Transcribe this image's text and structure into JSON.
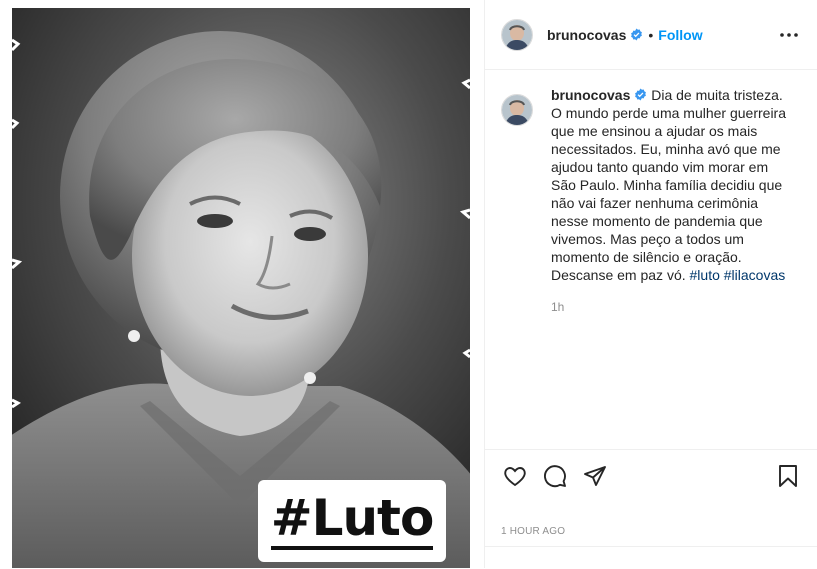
{
  "media": {
    "hashtag_overlay": "#Luto"
  },
  "header": {
    "username": "brunocovas",
    "separator": "•",
    "follow_label": "Follow",
    "more_icon": "more-horizontal-icon"
  },
  "caption": {
    "username": "brunocovas",
    "text": "Dia de muita tristeza. O mundo perde uma mulher guerreira que me ensinou a ajudar os mais necessitados. Eu, minha avó que me ajudou tanto quando vim morar em São Paulo. Minha família decidiu que não vai fazer nenhuma cerimônia nesse momento de pandemia que vivemos. Mas peço a todos um momento de silêncio e oração. Descanse em paz vó.",
    "hashtags": [
      "#luto",
      "#lilacovas"
    ],
    "relative_time": "1h"
  },
  "actions": {
    "like_icon": "heart-icon",
    "comment_icon": "comment-icon",
    "share_icon": "paper-plane-icon",
    "save_icon": "bookmark-icon"
  },
  "timestamp": "1 HOUR AGO",
  "colors": {
    "accent": "#0095f6",
    "hashtag": "#00376b",
    "verified": "#3897f0",
    "muted": "#8e8e8e"
  }
}
